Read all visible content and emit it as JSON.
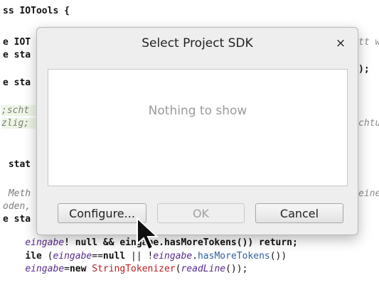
{
  "editor": {
    "lines": [
      {
        "text": "ss IOTools {",
        "bold": false
      },
      {
        "text": "e IOT",
        "bold": false
      },
      {
        "text": "e sta",
        "bold": false
      },
      {
        "text": "e sta",
        "bold": false
      },
      {
        "text": ";scht",
        "comment": true
      },
      {
        "text": "zlig;",
        "comment": true
      },
      {
        "text": " stat",
        "bold": true
      },
      {
        "text": " Meth",
        "comment": true
      },
      {
        "text": "oden,",
        "comment": true
      },
      {
        "text": "e sta",
        "bold": false
      }
    ],
    "right_fragments": {
      "r1": "tt w",
      "r2": ");",
      "r3": "chtu",
      "r4": "eine"
    },
    "line_eingabe_null": {
      "prefix": "eingabe",
      "rest": "! null && eingabe.hasMoreTokens()) return;"
    },
    "line_while": {
      "kw": "ile",
      "open": " (",
      "ident1": "eingabe",
      "mid": "==",
      "nullkw": "null",
      "or": " || ",
      "bang": "!",
      "ident2": "eingabe",
      "dot": ".",
      "method": "hasMoreTokens",
      "close": "())"
    },
    "line_new": {
      "ident": "eingabe",
      "eq": "=",
      "newkw": "new",
      "cls": " StringTokenizer",
      "paren": "(",
      "call": "readLine",
      "end": "());"
    }
  },
  "dialog": {
    "title": "Select Project SDK",
    "close_symbol": "×",
    "empty_text": "Nothing to show",
    "buttons": {
      "configure": "Configure...",
      "ok": "OK",
      "cancel": "Cancel"
    }
  }
}
